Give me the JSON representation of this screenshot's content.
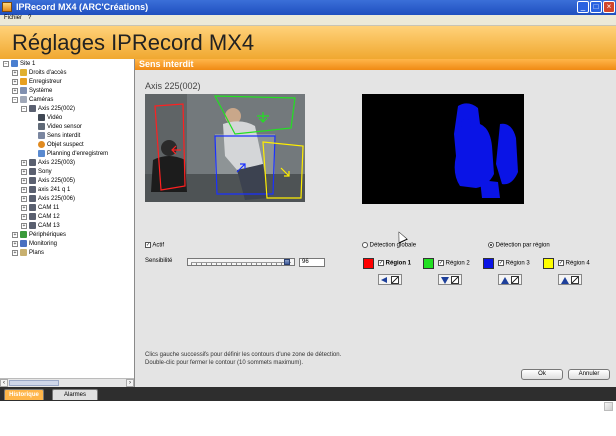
{
  "window": {
    "title": "IPRecord MX4 (ARC'Créations)"
  },
  "menu": {
    "items": [
      "Fichier",
      "?"
    ]
  },
  "header": {
    "title": "Réglages IPRecord MX4"
  },
  "tree": [
    {
      "label": "Site 1"
    },
    {
      "label": "Droits d'accès"
    },
    {
      "label": "Enregistreur"
    },
    {
      "label": "Système"
    },
    {
      "label": "Caméras"
    },
    {
      "label": "Axis 225(002)"
    },
    {
      "label": "Vidéo"
    },
    {
      "label": "Video sensor"
    },
    {
      "label": "Sens interdit"
    },
    {
      "label": "Objet suspect"
    },
    {
      "label": "Planning d'enregistrem"
    },
    {
      "label": "Axis 225(003)"
    },
    {
      "label": "Sony"
    },
    {
      "label": "Axis 225(005)"
    },
    {
      "label": "axis 241 q 1"
    },
    {
      "label": "Axis 225(006)"
    },
    {
      "label": "CAM 11"
    },
    {
      "label": "CAM 12"
    },
    {
      "label": "CAM 13"
    },
    {
      "label": "Périphériques"
    },
    {
      "label": "Monitoring"
    },
    {
      "label": "Plans"
    }
  ],
  "panel": {
    "title": "Sens interdit",
    "camera_label": "Axis 225(002)",
    "actif_label": "Actif",
    "sensibilite_label": "Sensibilité",
    "sensibilite_value": "96",
    "sensibilite_level": 0.96,
    "detection_globale_label": "Détection globale",
    "detection_region_label": "Détection par région",
    "regions": [
      {
        "label": "Région 1",
        "color": "#ff0000",
        "checked": true
      },
      {
        "label": "Région 2",
        "color": "#22e022",
        "checked": true
      },
      {
        "label": "Région 3",
        "color": "#0a14e6",
        "checked": true
      },
      {
        "label": "Région 4",
        "color": "#ffff00",
        "checked": true
      }
    ],
    "hint_line1": "Clics gauche successifs pour définir les contours d'une zone de détection.",
    "hint_line2": "Double-clic pour fermer le contour (10 sommets maximum).",
    "ok_label": "Ok",
    "cancel_label": "Annuler"
  },
  "bottom_tabs": [
    "Historique",
    "Alarmes"
  ]
}
